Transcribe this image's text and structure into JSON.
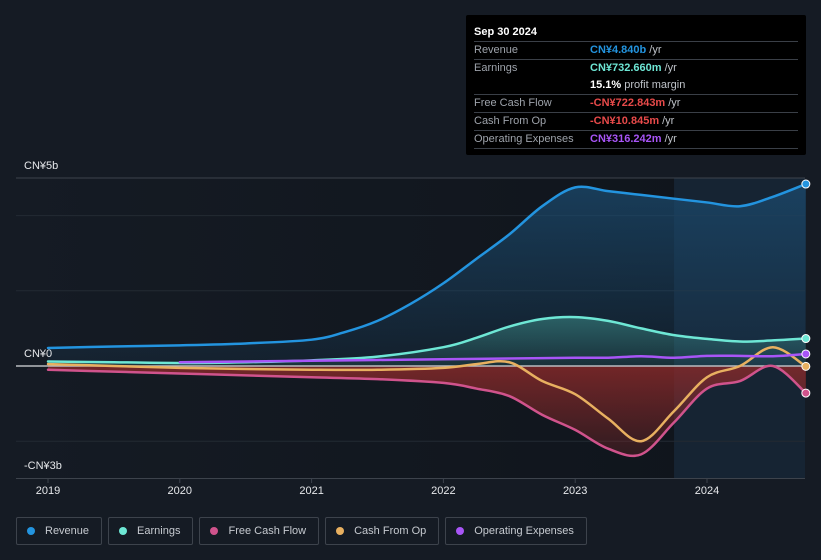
{
  "tooltip": {
    "date": "Sep 30 2024",
    "rows": [
      {
        "label": "Revenue",
        "value": "CN¥4.840b",
        "unit": "/yr",
        "color": "#2394df"
      },
      {
        "label": "Earnings",
        "value": "CN¥732.660m",
        "unit": "/yr",
        "color": "#6ee7d5"
      },
      {
        "label": "",
        "value": "15.1%",
        "unit": "profit margin",
        "color": "#ffffff"
      },
      {
        "label": "Free Cash Flow",
        "value": "-CN¥722.843m",
        "unit": "/yr",
        "color": "#e84a4a"
      },
      {
        "label": "Cash From Op",
        "value": "-CN¥10.845m",
        "unit": "/yr",
        "color": "#e84a4a"
      },
      {
        "label": "Operating Expenses",
        "value": "CN¥316.242m",
        "unit": "/yr",
        "color": "#a855f7"
      }
    ]
  },
  "chart_data": {
    "type": "line",
    "title": "",
    "xlabel": "",
    "ylabel": "",
    "y_unit": "CN¥ billions",
    "ylim": [
      -3,
      5
    ],
    "y_tick_labels": [
      "CN¥5b",
      "CN¥0",
      "-CN¥3b"
    ],
    "x_tick_labels": [
      "2019",
      "2020",
      "2021",
      "2022",
      "2023",
      "2024"
    ],
    "xlim": [
      2019.0,
      2024.75
    ],
    "forecast_shade_start": 2023.75,
    "grid": true,
    "legend_position": "bottom-left",
    "series": [
      {
        "name": "Revenue",
        "color": "#2394df",
        "x": [
          2019.0,
          2019.5,
          2020.0,
          2020.5,
          2021.0,
          2021.25,
          2021.5,
          2021.75,
          2022.0,
          2022.25,
          2022.5,
          2022.75,
          2023.0,
          2023.25,
          2023.5,
          2023.75,
          2024.0,
          2024.25,
          2024.5,
          2024.75
        ],
        "y": [
          0.48,
          0.52,
          0.55,
          0.6,
          0.7,
          0.9,
          1.2,
          1.65,
          2.2,
          2.85,
          3.5,
          4.25,
          4.75,
          4.65,
          4.55,
          4.45,
          4.35,
          4.25,
          4.5,
          4.84
        ]
      },
      {
        "name": "Earnings",
        "color": "#6ee7d5",
        "x": [
          2019.0,
          2019.5,
          2020.0,
          2020.5,
          2021.0,
          2021.5,
          2022.0,
          2022.25,
          2022.5,
          2022.75,
          2023.0,
          2023.25,
          2023.5,
          2023.75,
          2024.0,
          2024.25,
          2024.5,
          2024.75
        ],
        "y": [
          0.12,
          0.1,
          0.08,
          0.1,
          0.15,
          0.25,
          0.5,
          0.75,
          1.05,
          1.25,
          1.3,
          1.2,
          1.0,
          0.82,
          0.72,
          0.65,
          0.68,
          0.73
        ]
      },
      {
        "name": "Free Cash Flow",
        "color": "#d0538c",
        "x": [
          2019.0,
          2019.5,
          2020.0,
          2020.5,
          2021.0,
          2021.5,
          2022.0,
          2022.25,
          2022.5,
          2022.75,
          2023.0,
          2023.25,
          2023.5,
          2023.75,
          2024.0,
          2024.25,
          2024.5,
          2024.75
        ],
        "y": [
          -0.1,
          -0.15,
          -0.2,
          -0.25,
          -0.3,
          -0.35,
          -0.45,
          -0.6,
          -0.8,
          -1.3,
          -1.7,
          -2.2,
          -2.35,
          -1.5,
          -0.6,
          -0.4,
          0.0,
          -0.72
        ]
      },
      {
        "name": "Cash From Op",
        "color": "#e8b060",
        "x": [
          2019.0,
          2019.5,
          2020.0,
          2020.5,
          2021.0,
          2021.5,
          2022.0,
          2022.25,
          2022.5,
          2022.75,
          2023.0,
          2023.25,
          2023.5,
          2023.75,
          2024.0,
          2024.25,
          2024.5,
          2024.75
        ],
        "y": [
          0.05,
          0.0,
          -0.05,
          -0.08,
          -0.1,
          -0.1,
          -0.05,
          0.05,
          0.1,
          -0.4,
          -0.75,
          -1.4,
          -2.0,
          -1.2,
          -0.3,
          0.0,
          0.5,
          -0.01
        ]
      },
      {
        "name": "Operating Expenses",
        "color": "#a855f7",
        "x": [
          2020.0,
          2020.5,
          2021.0,
          2021.5,
          2022.0,
          2022.5,
          2023.0,
          2023.25,
          2023.5,
          2023.75,
          2024.0,
          2024.25,
          2024.5,
          2024.75
        ],
        "y": [
          0.1,
          0.12,
          0.14,
          0.16,
          0.18,
          0.2,
          0.22,
          0.22,
          0.26,
          0.22,
          0.27,
          0.27,
          0.26,
          0.32
        ]
      }
    ]
  },
  "legend": [
    {
      "label": "Revenue",
      "color": "#2394df"
    },
    {
      "label": "Earnings",
      "color": "#6ee7d5"
    },
    {
      "label": "Free Cash Flow",
      "color": "#d0538c"
    },
    {
      "label": "Cash From Op",
      "color": "#e8b060"
    },
    {
      "label": "Operating Expenses",
      "color": "#a855f7"
    }
  ]
}
